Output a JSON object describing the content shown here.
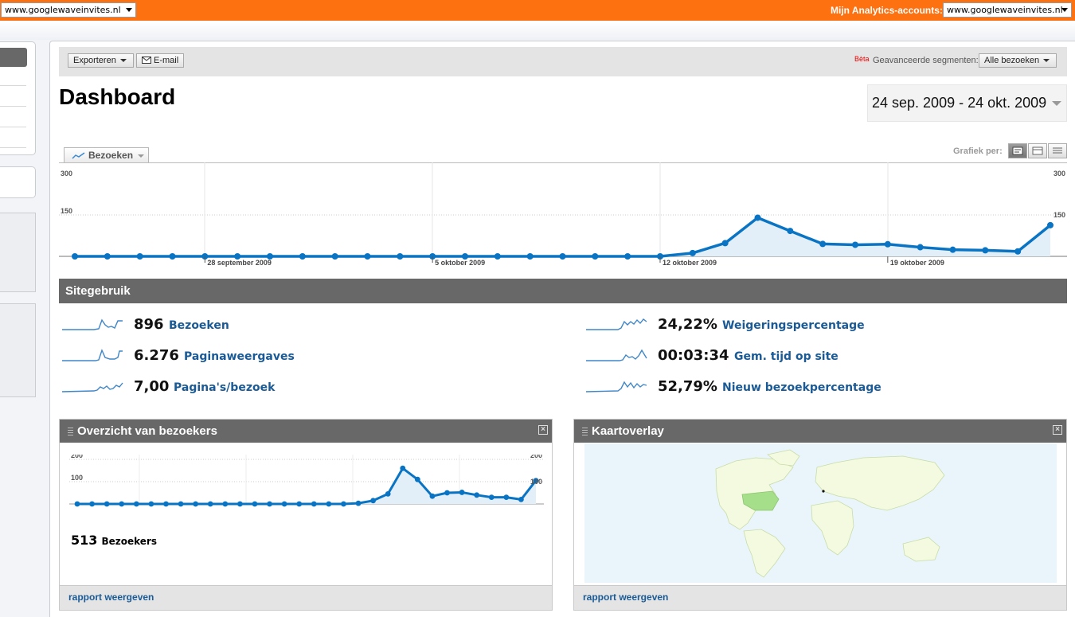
{
  "header": {
    "profile_select": "www.googlewaveinvites.nl",
    "accounts_label": "Mijn Analytics-accounts:",
    "accounts_select": "www.googlewaveinvites.nl"
  },
  "toolbar": {
    "export_label": "Exporteren",
    "email_label": "E-mail",
    "beta": "Bèta",
    "segments_label": "Geavanceerde segmenten:",
    "segments_value": "Alle bezoeken"
  },
  "page": {
    "title": "Dashboard",
    "date_range": "24 sep. 2009 - 24 okt. 2009"
  },
  "graph": {
    "tab_label": "Bezoeken",
    "grafiek_label": "Grafiek per:"
  },
  "site_usage": {
    "title": "Sitegebruik",
    "metrics": [
      {
        "value": "896",
        "label": "Bezoeken"
      },
      {
        "value": "6.276",
        "label": "Paginaweergaves"
      },
      {
        "value": "7,00",
        "label": "Pagina's/bezoek"
      },
      {
        "value": "24,22%",
        "label": "Weigeringspercentage"
      },
      {
        "value": "00:03:34",
        "label": "Gem. tijd op site"
      },
      {
        "value": "52,79%",
        "label": "Nieuw bezoekpercentage"
      }
    ]
  },
  "visitors_widget": {
    "title": "Overzicht van bezoekers",
    "count": "513",
    "count_label": "Bezoekers",
    "footer_link": "rapport weergeven"
  },
  "map_widget": {
    "title": "Kaartoverlay",
    "footer_link": "rapport weergeven"
  },
  "colors": {
    "accent_orange": "#fe7110",
    "line_blue": "#0a74c4",
    "link_blue": "#1a5a96",
    "bar_gray": "#686868"
  },
  "chart_data": [
    {
      "type": "line",
      "name": "main-visits-chart",
      "title": "",
      "x": [
        "24 sep",
        "25 sep",
        "26 sep",
        "27 sep",
        "28 sep",
        "29 sep",
        "30 sep",
        "1 okt",
        "2 okt",
        "3 okt",
        "4 okt",
        "5 okt",
        "6 okt",
        "7 okt",
        "8 okt",
        "9 okt",
        "10 okt",
        "11 okt",
        "12 okt",
        "13 okt",
        "14 okt",
        "15 okt",
        "16 okt",
        "17 okt",
        "18 okt",
        "19 okt",
        "20 okt",
        "21 okt",
        "22 okt",
        "23 okt",
        "24 okt"
      ],
      "series": [
        {
          "values": [
            0,
            0,
            0,
            0,
            0,
            0,
            0,
            0,
            0,
            0,
            0,
            0,
            0,
            0,
            0,
            0,
            0,
            0,
            0,
            12,
            48,
            140,
            92,
            45,
            42,
            44,
            33,
            24,
            22,
            18,
            113
          ]
        }
      ],
      "x_tick_labels": [
        "28 september 2009",
        "5 oktober 2009",
        "12 oktober 2009",
        "19 oktober 2009"
      ],
      "y_tick_labels": [
        "300",
        "150"
      ],
      "ylim": [
        0,
        300
      ],
      "grid": true
    },
    {
      "type": "line",
      "name": "visitors-overview-chart",
      "title": "",
      "x": [
        "24 sep",
        "25 sep",
        "26 sep",
        "27 sep",
        "28 sep",
        "29 sep",
        "30 sep",
        "1 okt",
        "2 okt",
        "3 okt",
        "4 okt",
        "5 okt",
        "6 okt",
        "7 okt",
        "8 okt",
        "9 okt",
        "10 okt",
        "11 okt",
        "12 okt",
        "13 okt",
        "14 okt",
        "15 okt",
        "16 okt",
        "17 okt",
        "18 okt",
        "19 okt",
        "20 okt",
        "21 okt",
        "22 okt",
        "23 okt",
        "24 okt"
      ],
      "series": [
        {
          "values": [
            0,
            0,
            0,
            0,
            0,
            0,
            0,
            0,
            0,
            0,
            0,
            0,
            0,
            0,
            0,
            0,
            0,
            0,
            0,
            3,
            15,
            45,
            160,
            110,
            35,
            50,
            52,
            40,
            30,
            30,
            20,
            105
          ]
        }
      ],
      "y_tick_labels": [
        "200",
        "100"
      ],
      "ylim": [
        0,
        200
      ],
      "grid": true
    }
  ]
}
